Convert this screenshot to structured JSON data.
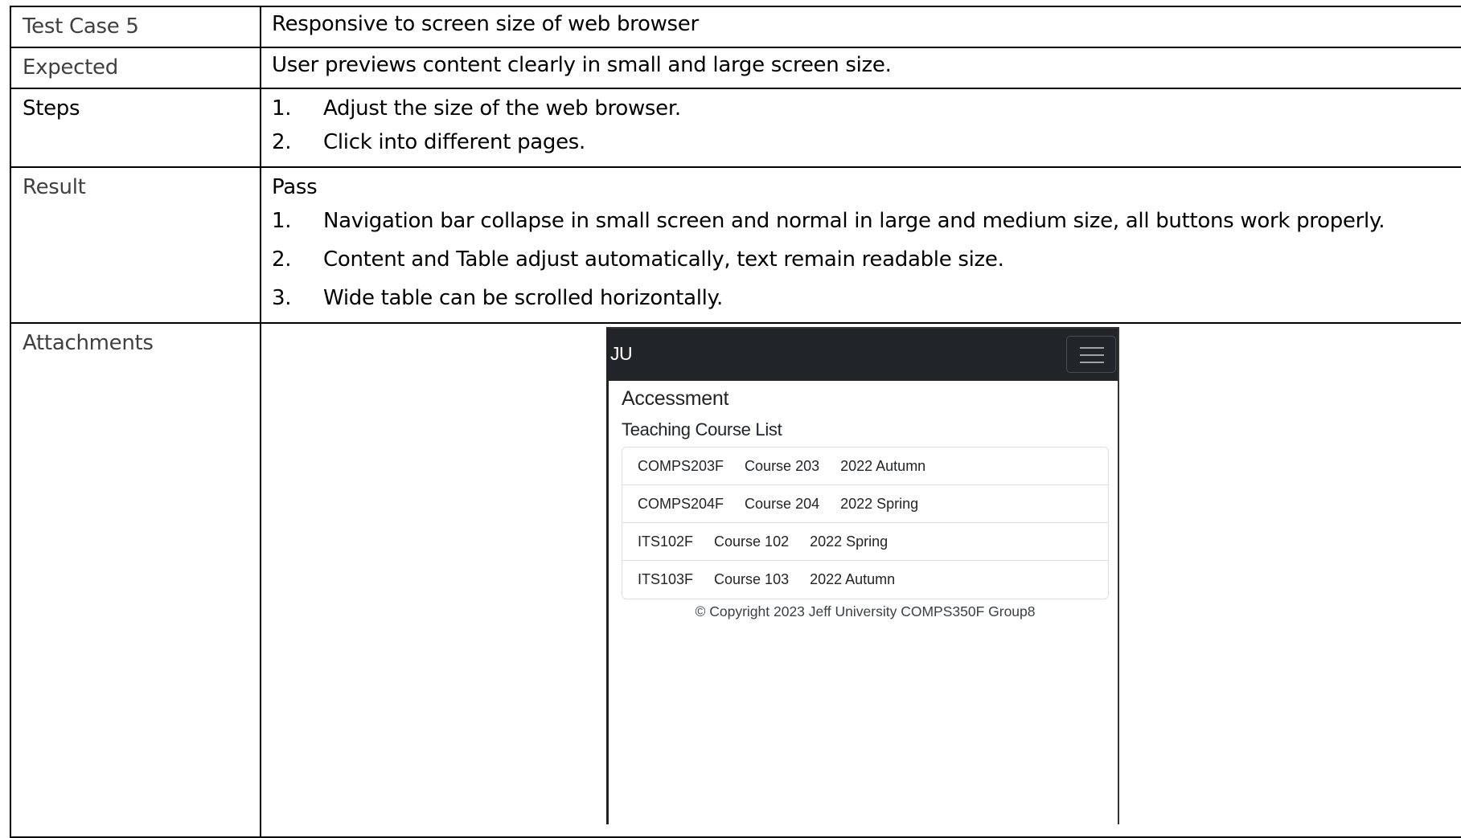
{
  "rows": {
    "test_case": {
      "label": "Test Case 5",
      "value": "Responsive to screen size of web browser"
    },
    "expected": {
      "label": "Expected",
      "value": "User previews content clearly in small and large screen size."
    },
    "steps": {
      "label": "Steps",
      "items": [
        {
          "num": "1.",
          "text": "Adjust the size of the web browser."
        },
        {
          "num": "2.",
          "text": "Click into different pages."
        }
      ]
    },
    "result": {
      "label": "Result",
      "status": "Pass",
      "items": [
        {
          "num": "1.",
          "text": "Navigation bar collapse in small screen and normal in large and medium size, all buttons work properly."
        },
        {
          "num": "2.",
          "text": "Content and Table adjust automatically, text remain readable size."
        },
        {
          "num": "3.",
          "text": "Wide table can be scrolled horizontally."
        }
      ]
    },
    "attachments": {
      "label": "Attachments"
    }
  },
  "screenshot": {
    "brand": "JU",
    "toggler_icon": "hamburger-menu-icon",
    "nav_bg": "#212529",
    "heading": "Accessment",
    "subheading": "Teaching Course List",
    "courses": [
      {
        "code": "COMPS203F",
        "name": "Course 203",
        "term": "2022 Autumn"
      },
      {
        "code": "COMPS204F",
        "name": "Course 204",
        "term": "2022 Spring"
      },
      {
        "code": "ITS102F",
        "name": "Course 102",
        "term": "2022 Spring"
      },
      {
        "code": "ITS103F",
        "name": "Course 103",
        "term": "2022 Autumn"
      }
    ],
    "copyright": "© Copyright 2023 Jeff University COMPS350F Group8"
  }
}
